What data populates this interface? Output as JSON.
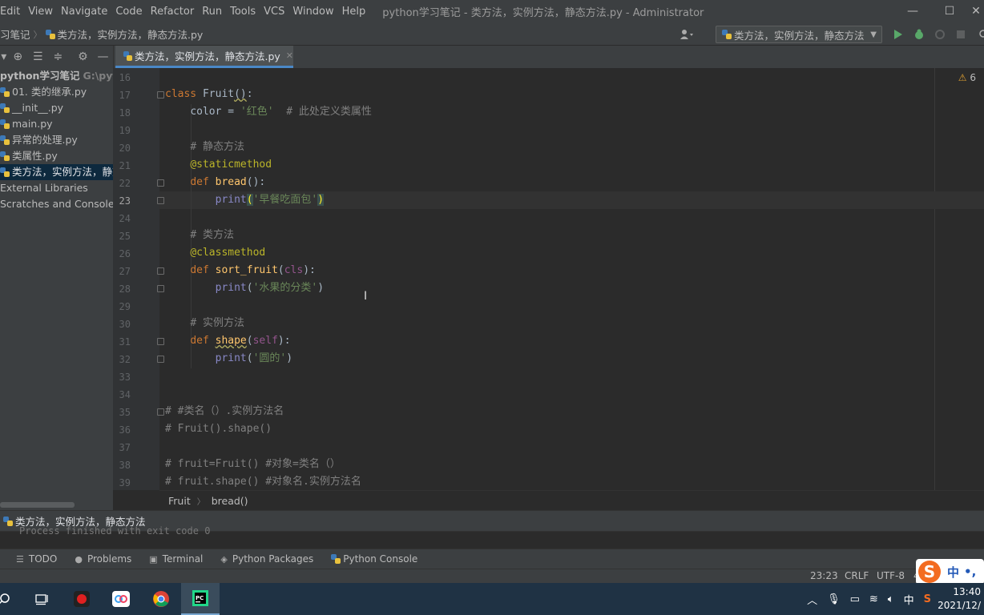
{
  "menubar": {
    "items": [
      "Edit",
      "View",
      "Navigate",
      "Code",
      "Refactor",
      "Run",
      "Tools",
      "VCS",
      "Window",
      "Help"
    ],
    "window_title": "python学习笔记 - 类方法，实例方法，静态方法.py - Administrator"
  },
  "navbar": {
    "project_crumb": "习笔记",
    "file_crumb": "类方法，实例方法，静态方法.py",
    "run_config": "类方法，实例方法，静态方法"
  },
  "project_panel": {
    "root_name": "python学习笔记",
    "root_path": "G:\\pytho",
    "files": [
      {
        "name": "01. 类的继承.py"
      },
      {
        "name": "__init__.py"
      },
      {
        "name": "main.py"
      },
      {
        "name": "异常的处理.py"
      },
      {
        "name": "类属性.py"
      },
      {
        "name": "类方法，实例方法，静态方法.py"
      }
    ],
    "external_libraries": "External Libraries",
    "scratches": "Scratches and Consoles"
  },
  "editor": {
    "tab_label": "类方法，实例方法，静态方法.py",
    "warning_count": "6",
    "line_numbers": [
      "16",
      "17",
      "18",
      "19",
      "20",
      "21",
      "22",
      "23",
      "24",
      "25",
      "26",
      "27",
      "28",
      "29",
      "30",
      "31",
      "32",
      "33",
      "34",
      "35",
      "36",
      "37",
      "38",
      "39"
    ],
    "current_line": "23"
  },
  "code": {
    "class_kw": "class",
    "class_name": "Fruit",
    "class_paren": "()",
    "color_assign": "color = ",
    "color_str": "'红色'",
    "color_cmt": "# 此处定义类属性",
    "static_cmt": "# 静态方法",
    "staticmethod": "@staticmethod",
    "def": "def",
    "bread": "bread",
    "paren_colon": "():",
    "print": "print",
    "bread_str": "'早餐吃面包'",
    "class_cmt": "# 类方法",
    "classmethod": "@classmethod",
    "sort_fruit": "sort_fruit",
    "cls": "cls",
    "sort_str": "'水果的分类'",
    "inst_cmt": "# 实例方法",
    "shape": "shape",
    "self": "self",
    "shape_str": "'圆的'",
    "c35": "# #类名（）.实例方法名",
    "c36": "# Fruit().shape()",
    "c38": "# fruit=Fruit() #对象=类名（）",
    "c39": "# fruit.shape() #对象名.实例方法名"
  },
  "breadcrumb": {
    "class": "Fruit",
    "method": "bread()"
  },
  "run_panel": {
    "tab_label": "类方法，实例方法，静态方法",
    "clipped_output": "Process finished with exit code 0"
  },
  "tool_windows": [
    "TODO",
    "Problems",
    "Terminal",
    "Python Packages",
    "Python Console"
  ],
  "status": {
    "position": "23:23",
    "line_sep": "CRLF",
    "encoding": "UTF-8",
    "indent": "4"
  },
  "ime": {
    "mode": "中",
    "punct": "•,"
  },
  "taskbar": {
    "lang": "中",
    "time": "13:40",
    "date": "2021/12/"
  },
  "colors": {
    "accent": "#4a88c7",
    "background": "#2b2b2b",
    "panel": "#3c3f41",
    "taskbar": "#1f3244"
  }
}
